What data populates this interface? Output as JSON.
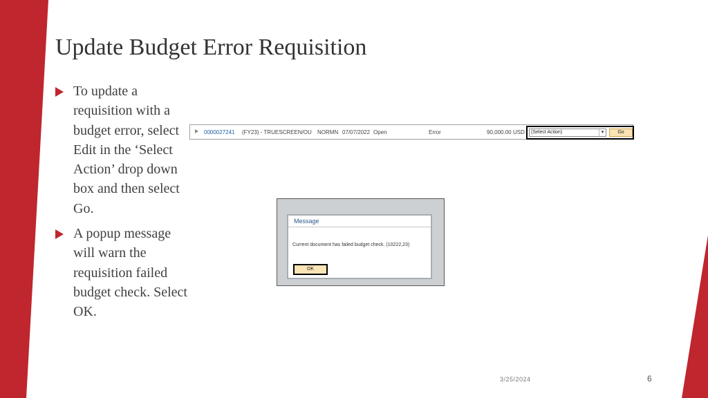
{
  "slide": {
    "title": "Update Budget Error Requisition",
    "bullets": [
      "To update a requisition with a budget error, select Edit in the ‘Select Action’ drop down box and then select Go.",
      "A popup message will warn the requisition failed budget check. Select OK."
    ],
    "date": "3/25/2024",
    "page_number": "6"
  },
  "requisition_row": {
    "id": "0000027241",
    "description": "(FY23) - TRUESCREEN/OU",
    "requester": "NORMN",
    "date": "07/07/2022",
    "status": "Open",
    "budget_status": "Error",
    "amount": "90,000.00",
    "currency": "USD",
    "action_placeholder": "(Select Action)",
    "go_label": "Go"
  },
  "popup": {
    "title": "Message",
    "message": "Current document has failed budget check. (10222,23)",
    "ok_label": "OK"
  },
  "colors": {
    "accent_red": "#c0262d",
    "link_blue": "#1f5fa8",
    "button_fill": "#fbe4b4"
  },
  "icons": {
    "bullet": "red-triangle",
    "row_expand": "gray-triangle",
    "select_arrow": "chevron-down"
  }
}
